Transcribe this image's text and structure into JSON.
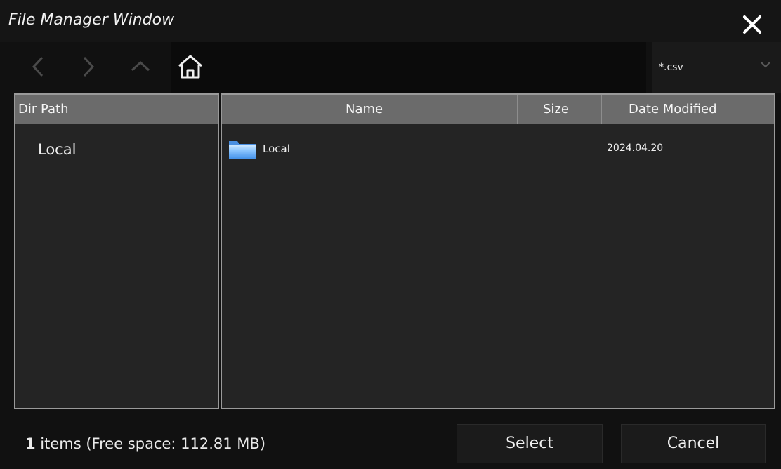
{
  "window": {
    "title": "File Manager Window"
  },
  "toolbar": {
    "back_icon": "chevron-left-icon",
    "forward_icon": "chevron-right-icon",
    "up_icon": "chevron-up-icon",
    "home_icon": "home-icon",
    "path": "",
    "filter": {
      "selected": "*.csv",
      "icon": "chevron-down-icon"
    }
  },
  "dir_pane": {
    "header": "Dir Path",
    "items": [
      {
        "label": "Local"
      }
    ]
  },
  "file_pane": {
    "columns": [
      "Name",
      "Size",
      "Date Modified"
    ],
    "rows": [
      {
        "icon": "folder-icon",
        "name": "Local",
        "size": "",
        "date": "2024.04.20"
      }
    ]
  },
  "footer": {
    "count": "1",
    "status_rest": " items (Free space: 112.81 MB)",
    "select_label": "Select",
    "cancel_label": "Cancel"
  },
  "colors": {
    "background": "#111111",
    "pane": "#242424",
    "header": "#6b6b6b",
    "border": "#9a9a9a",
    "text": "#f0f0f0"
  }
}
